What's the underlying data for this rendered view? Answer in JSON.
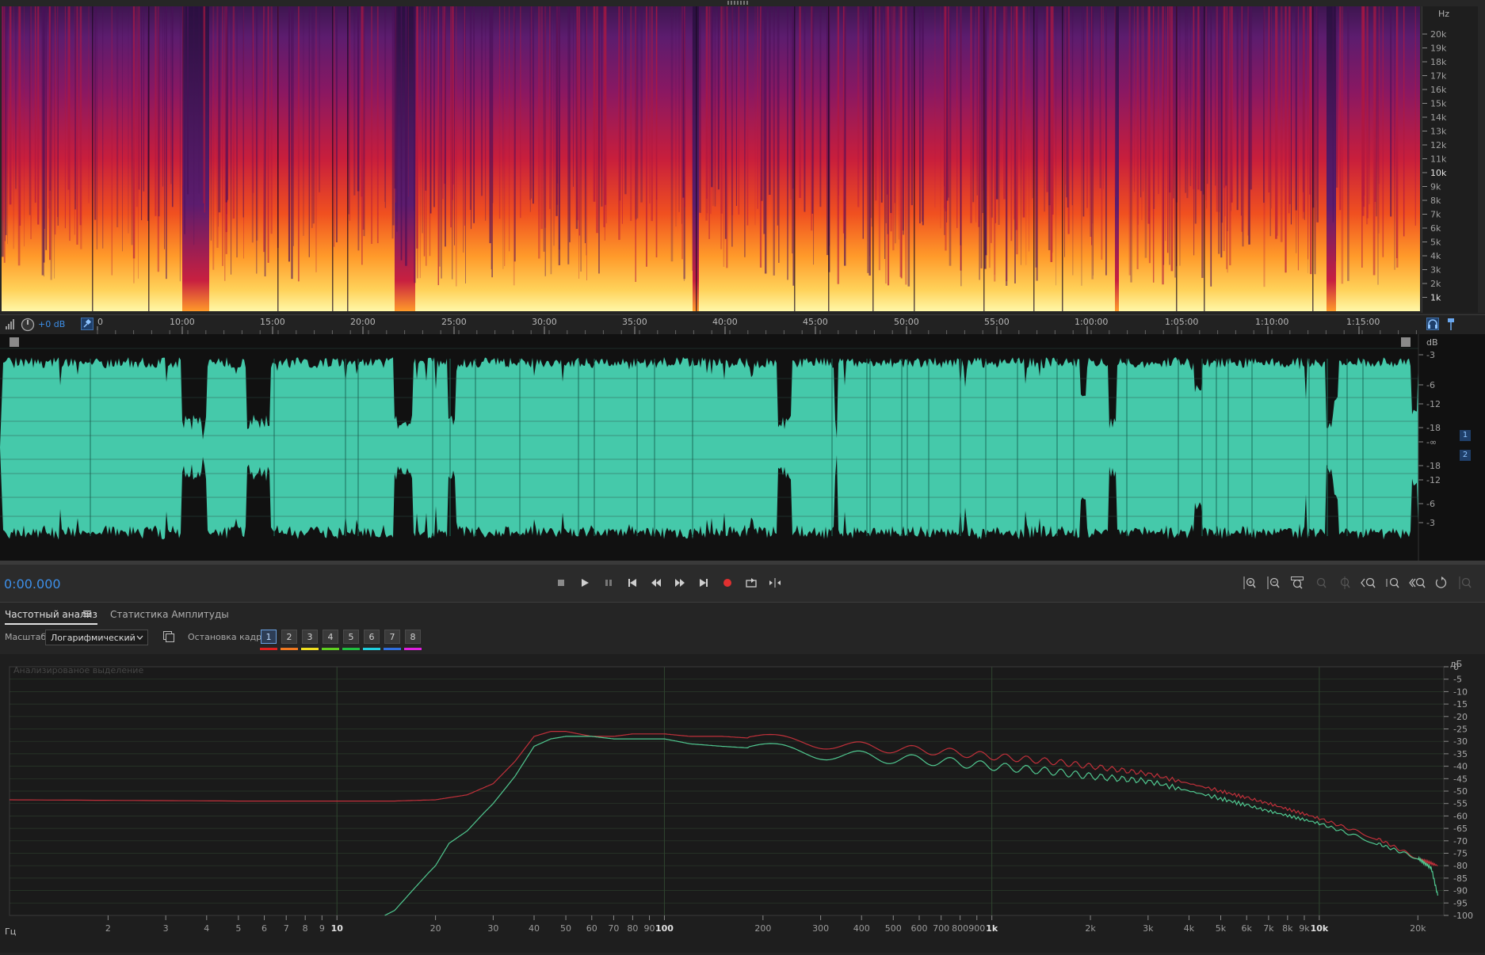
{
  "spectrogram": {
    "hz_unit": "Hz",
    "hz_labels": [
      "20k",
      "19k",
      "18k",
      "17k",
      "16k",
      "15k",
      "14k",
      "13k",
      "12k",
      "11k",
      "10k",
      "9k",
      "8k",
      "7k",
      "6k",
      "5k",
      "4k",
      "3k",
      "2k",
      "1k"
    ],
    "max_frequency_khz": 22
  },
  "time_ruler": {
    "gain": "+0 dB",
    "labels": [
      "0",
      "10:00",
      "15:00",
      "20:00",
      "25:00",
      "30:00",
      "35:00",
      "40:00",
      "45:00",
      "50:00",
      "55:00",
      "1:00:00",
      "1:05:00",
      "1:10:00",
      "1:15:00"
    ],
    "waveform_color": "#45c9aa"
  },
  "waveform": {
    "db_unit": "dB",
    "db_labels": [
      "-3",
      "-6",
      "-12",
      "-18",
      "-∞",
      "-18",
      "-12",
      "-6",
      "-3"
    ],
    "channels": [
      "1",
      "2"
    ]
  },
  "transport": {
    "time": "0:00.000",
    "time_color": "#3d8fe8",
    "record_color": "#e03030"
  },
  "tabs": {
    "frequency_analysis": "Частотный анализ",
    "amplitude_statistics": "Статистика Амплитуды"
  },
  "options": {
    "scale_label": "Масштаб:",
    "scale_value": "Логарифмический",
    "freeze_label": "Остановка кадра:",
    "frame_buttons": [
      "1",
      "2",
      "3",
      "4",
      "5",
      "6",
      "7",
      "8"
    ],
    "frame_colors": [
      "#e02020",
      "#f07820",
      "#f0e020",
      "#60d020",
      "#20c040",
      "#20d0e0",
      "#3070e0",
      "#e020e0"
    ]
  },
  "frequency_analysis": {
    "watermark": "Анализированое выделение",
    "db_unit": "дБ",
    "x_unit": "Гц",
    "x_labels": [
      "2",
      "3",
      "4",
      "5",
      "6",
      "7",
      "8",
      "9",
      "10",
      "20",
      "30",
      "40",
      "50",
      "60",
      "70",
      "80",
      "90",
      "100",
      "200",
      "300",
      "400",
      "500",
      "600",
      "700",
      "800",
      "900",
      "1k",
      "2k",
      "3k",
      "4k",
      "5k",
      "6k",
      "7k",
      "8k",
      "9k",
      "10k",
      "20k"
    ],
    "db_labels": [
      "0",
      "-5",
      "-10",
      "-15",
      "-20",
      "-25",
      "-30",
      "-35",
      "-40",
      "-45",
      "-50",
      "-55",
      "-60",
      "-65",
      "-70",
      "-75",
      "-80",
      "-85",
      "-90",
      "-95",
      "-100"
    ]
  },
  "chart_data": {
    "type": "line",
    "xlabel": "Гц",
    "ylabel": "дБ",
    "x_scale": "log",
    "xlim": [
      1,
      24000
    ],
    "ylim": [
      -100,
      0
    ],
    "grid": true,
    "series": [
      {
        "color": "#c0303a",
        "x": [
          1,
          5,
          10,
          15,
          20,
          25,
          30,
          35,
          40,
          45,
          50,
          60,
          70,
          80,
          100,
          120,
          150,
          200,
          300,
          500,
          700,
          1000,
          1500,
          2000,
          3000,
          5000,
          7000,
          10000,
          15000,
          20000,
          23000
        ],
        "y": [
          -53.5,
          -54,
          -54,
          -54,
          -53.5,
          -51.5,
          -47,
          -38,
          -28,
          -26,
          -26,
          -28,
          -28,
          -27,
          -27,
          -28,
          -28,
          -29,
          -31,
          -33,
          -34,
          -36,
          -38,
          -40,
          -43,
          -50,
          -55,
          -61,
          -69,
          -77,
          -80
        ]
      },
      {
        "color": "#50c890",
        "x": [
          14,
          15,
          17,
          19,
          20,
          22,
          25,
          28,
          30,
          35,
          40,
          45,
          50,
          60,
          70,
          80,
          100,
          120,
          150,
          200,
          300,
          500,
          700,
          1000,
          1500,
          2000,
          3000,
          5000,
          7000,
          10000,
          15000,
          20000,
          22000,
          23000
        ],
        "y": [
          -100,
          -98,
          -90,
          -83,
          -80,
          -71,
          -66,
          -59,
          -55,
          -44,
          -32,
          -29,
          -28,
          -28,
          -29,
          -29,
          -29,
          -31,
          -32,
          -33,
          -35,
          -37,
          -38,
          -40,
          -42,
          -44,
          -46,
          -53,
          -58,
          -63,
          -71,
          -77,
          -81,
          -92
        ]
      }
    ]
  }
}
